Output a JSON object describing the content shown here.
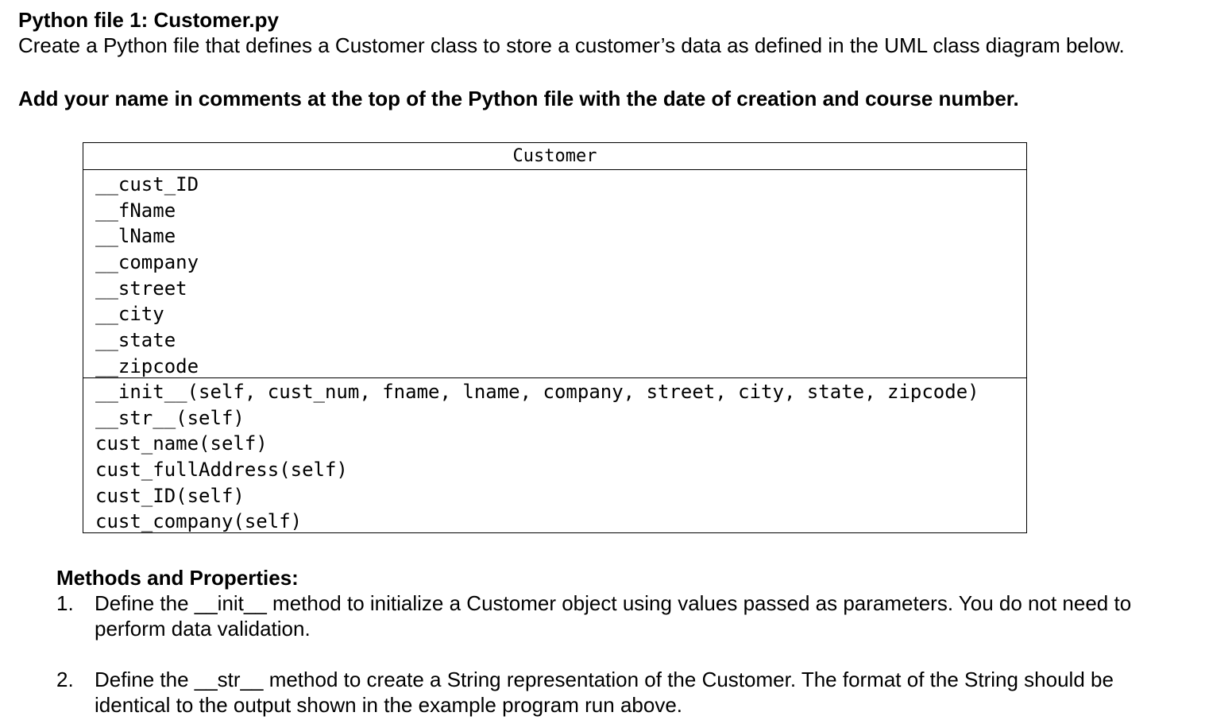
{
  "heading": "Python file 1: Customer.py",
  "intro": "Create a Python file that defines a Customer class to store a customer’s data as defined in the UML class diagram below.",
  "instruction": "Add your name in comments at the top of the Python file with the date of creation and course number.",
  "uml": {
    "class_name": "Customer",
    "attributes": [
      "__cust_ID",
      "__fName",
      "__lName",
      "__company",
      "__street",
      "__city",
      "__state",
      "__zipcode"
    ],
    "methods": [
      "__init__(self, cust_num, fname, lname, company, street, city, state, zipcode)",
      "__str__(self)",
      "cust_name(self)",
      "cust_fullAddress(self)",
      "cust_ID(self)",
      "cust_company(self)"
    ]
  },
  "methods_section": {
    "title": "Methods and Properties:",
    "items": [
      {
        "number": "1.",
        "text": "Define the __init__ method to initialize a Customer object using values passed as parameters. You do not need to perform data validation."
      },
      {
        "number": "2.",
        "text": "Define the __str__ method to create a String representation of the Customer. The format of the String should be identical to the output shown in the example program run above."
      }
    ]
  }
}
